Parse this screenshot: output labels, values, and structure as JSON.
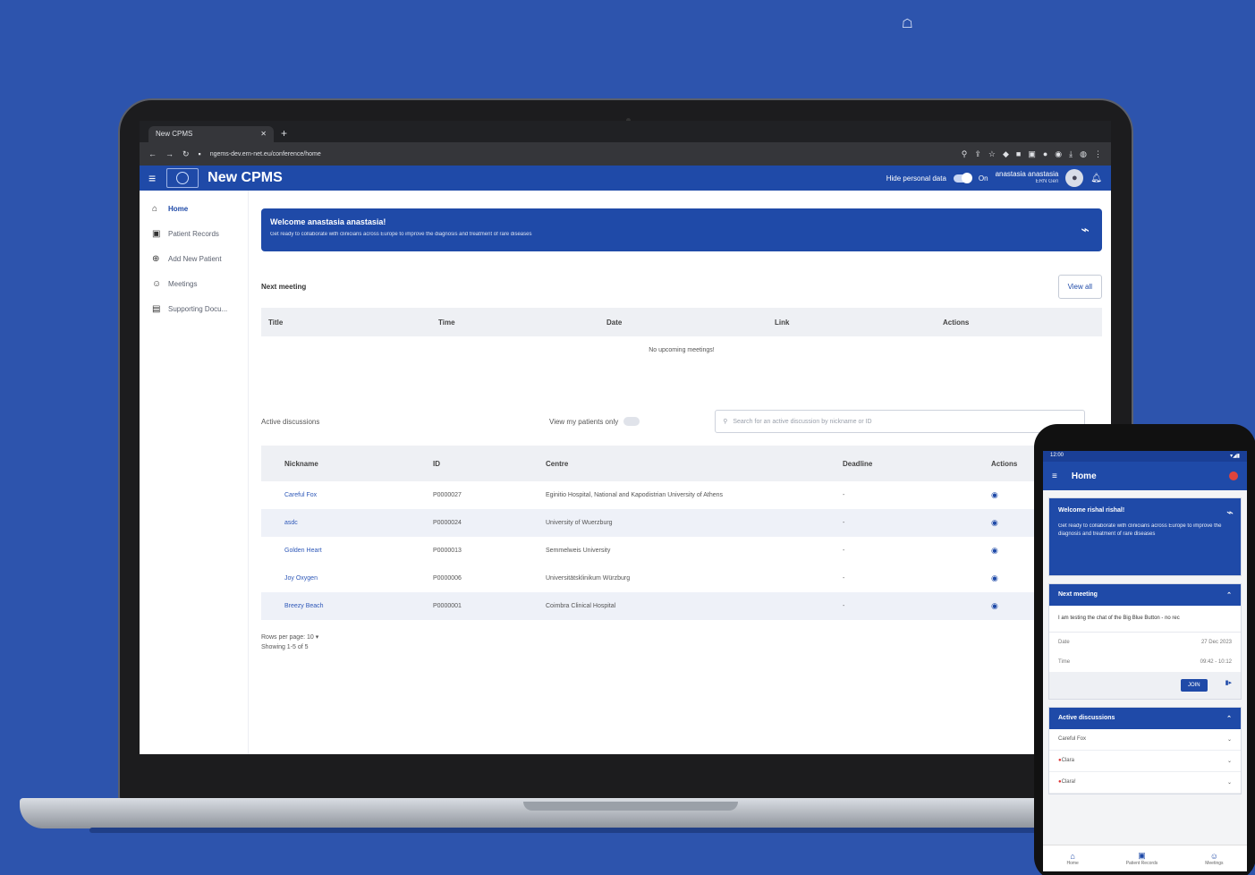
{
  "decor": {
    "top_glyph": "☖"
  },
  "browser": {
    "tab_title": "New CPMS",
    "url": "ngems-dev.ern-net.eu/conference/home",
    "new_tab": "+"
  },
  "app": {
    "title": "New CPMS",
    "hide_personal_label": "Hide personal data",
    "toggle_state": "On",
    "user_name": "anastasia anastasia",
    "user_role": "ERN Gen"
  },
  "sidebar": {
    "items": [
      {
        "label": "Home",
        "icon": "home-icon",
        "glyph": "⌂"
      },
      {
        "label": "Patient Records",
        "icon": "folder-icon",
        "glyph": "▣"
      },
      {
        "label": "Add New Patient",
        "icon": "add-circle-icon",
        "glyph": "⊕"
      },
      {
        "label": "Meetings",
        "icon": "people-icon",
        "glyph": "☺"
      },
      {
        "label": "Supporting Docu...",
        "icon": "document-icon",
        "glyph": "▤"
      }
    ]
  },
  "welcome": {
    "title": "Welcome anastasia anastasia!",
    "subtitle": "Get ready to collaborate with clinicians across Europe to improve the diagnosis and treatment of rare diseases"
  },
  "meetings": {
    "title": "Next meeting",
    "view_all": "View all",
    "columns": [
      "Title",
      "Time",
      "Date",
      "Link",
      "Actions"
    ],
    "empty": "No upcoming meetings!"
  },
  "discussions": {
    "title": "Active discussions",
    "my_patients_label": "View my patients only",
    "search_placeholder": "Search for an active discussion by nickname or ID",
    "columns": [
      "Nickname",
      "ID",
      "Centre",
      "Deadline",
      "Actions"
    ],
    "rows": [
      {
        "nickname": "Careful Fox",
        "id": "P0000027",
        "centre": "Eginitio Hospital, National and Kapodistrian University of Athens",
        "deadline": "-"
      },
      {
        "nickname": "asdc",
        "id": "P0000024",
        "centre": "University of Wuerzburg",
        "deadline": "-"
      },
      {
        "nickname": "Golden Heart",
        "id": "P0000013",
        "centre": "Semmelweis University",
        "deadline": "-"
      },
      {
        "nickname": "Joy Oxygen",
        "id": "P0000006",
        "centre": "Universitätsklinikum Würzburg",
        "deadline": "-"
      },
      {
        "nickname": "Breezy Beach",
        "id": "P0000001",
        "centre": "Coimbra Clinical Hospital",
        "deadline": "-"
      }
    ],
    "rows_per_page_label": "Rows per page:",
    "rows_per_page": "10",
    "showing": "Showing 1-5 of 5"
  },
  "phone": {
    "status_time": "12:00",
    "title": "Home",
    "welcome_title": "Welcome rishal rishal!",
    "welcome_text": "Get ready to collaborate with clinicians across Europe to improve the diagnosis and treatment of rare diseases",
    "next_meeting": "Next meeting",
    "meeting_text": "I am testing the chat of the Big Blue Button - no rec",
    "date_label": "Date",
    "date_value": "27 Dec 2023",
    "time_label": "Time",
    "time_value": "09:42 - 10:12",
    "join": "JOIN",
    "active_discussions": "Active discussions",
    "list": [
      "Careful Fox",
      "Clara",
      "Clara!"
    ],
    "nav": [
      "Home",
      "Patient Records",
      "Meetings"
    ]
  }
}
